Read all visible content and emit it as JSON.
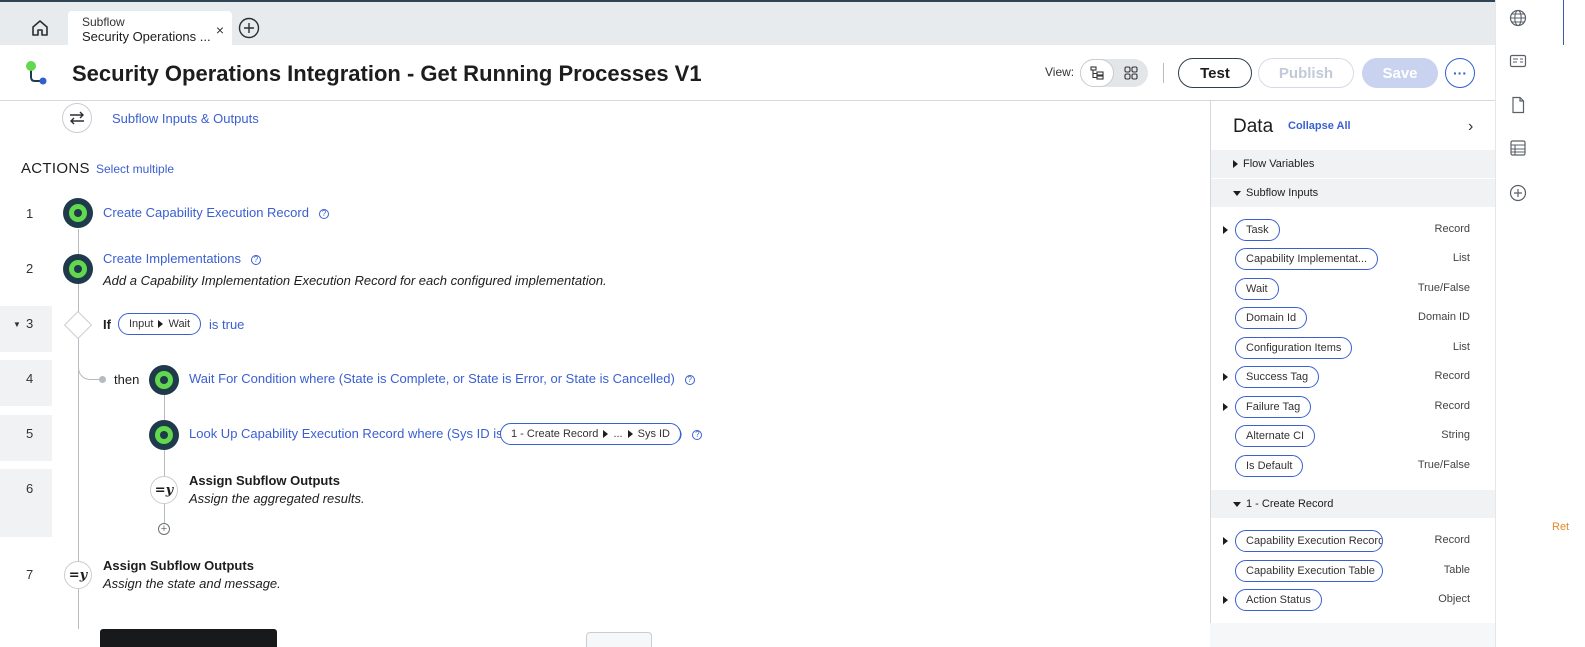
{
  "tabs": {
    "home_icon": "home-icon",
    "active_tab": {
      "kicker": "Subflow",
      "title": "Security Operations ..."
    },
    "close_glyph": "×",
    "add_icon": "add-tab-icon"
  },
  "header": {
    "title": "Security Operations Integration - Get Running Processes V1",
    "view_label": "View:",
    "test_label": "Test",
    "publish_label": "Publish",
    "save_label": "Save",
    "more_glyph": "···"
  },
  "colors": {
    "accent": "#3a5fd1",
    "step_dark": "#1f3a4a",
    "step_green": "#62d84e",
    "save_disabled": "#c9d2ee",
    "ret_orange": "#e3892b"
  },
  "canvas": {
    "io_link": "Subflow Inputs & Outputs",
    "actions_title": "ACTIONS",
    "select_multiple": "Select multiple",
    "steps": [
      {
        "num": "1",
        "label": "Create Capability Execution Record"
      },
      {
        "num": "2",
        "label": "Create Implementations",
        "desc": "Add a Capability Implementation Execution Record for each configured implementation."
      },
      {
        "num": "3",
        "if": "If",
        "pill_a": "Input",
        "pill_b": "Wait",
        "condition": "is true"
      },
      {
        "num": "4",
        "then": "then",
        "label": "Wait For Condition where (State is Complete, or State is Error, or State is Cancelled)"
      },
      {
        "num": "5",
        "label": "Look Up Capability Execution Record where (Sys ID is",
        "pill_a": "1 - Create Record",
        "pill_b": "...",
        "pill_c": "Sys ID",
        "close": ")"
      },
      {
        "num": "6",
        "title": "Assign Subflow Outputs",
        "desc": "Assign the aggregated results.",
        "icon_text": "=y"
      },
      {
        "num": "7",
        "title": "Assign Subflow Outputs",
        "desc": "Assign the state and message.",
        "icon_text": "=y"
      }
    ],
    "help_glyph": "?",
    "add_glyph": "+"
  },
  "panel": {
    "title": "Data",
    "collapse_all": "Collapse All",
    "close_glyph": "›",
    "sections": {
      "flow_vars": "Flow Variables",
      "subflow_inputs": "Subflow Inputs",
      "create_record": "1 - Create Record"
    },
    "inputs": [
      {
        "name": "Task",
        "type": "Record",
        "expandable": true
      },
      {
        "name": "Capability Implementat...",
        "type": "List",
        "expandable": false
      },
      {
        "name": "Wait",
        "type": "True/False",
        "expandable": false
      },
      {
        "name": "Domain Id",
        "type": "Domain ID",
        "expandable": false
      },
      {
        "name": "Configuration Items",
        "type": "List",
        "expandable": false
      },
      {
        "name": "Success Tag",
        "type": "Record",
        "expandable": true
      },
      {
        "name": "Failure Tag",
        "type": "Record",
        "expandable": true
      },
      {
        "name": "Alternate CI",
        "type": "String",
        "expandable": false
      },
      {
        "name": "Is Default",
        "type": "True/False",
        "expandable": false
      }
    ],
    "create_record_items": [
      {
        "name": "Capability Execution Record",
        "type": "Record",
        "expandable": true
      },
      {
        "name": "Capability Execution Table",
        "type": "Table",
        "expandable": false
      },
      {
        "name": "Action Status",
        "type": "Object",
        "expandable": true
      }
    ]
  },
  "rail": {
    "icons": [
      "globe-icon",
      "id-card-icon",
      "document-icon",
      "table-icon",
      "add-circle-icon"
    ],
    "edge_text": "Ret"
  }
}
